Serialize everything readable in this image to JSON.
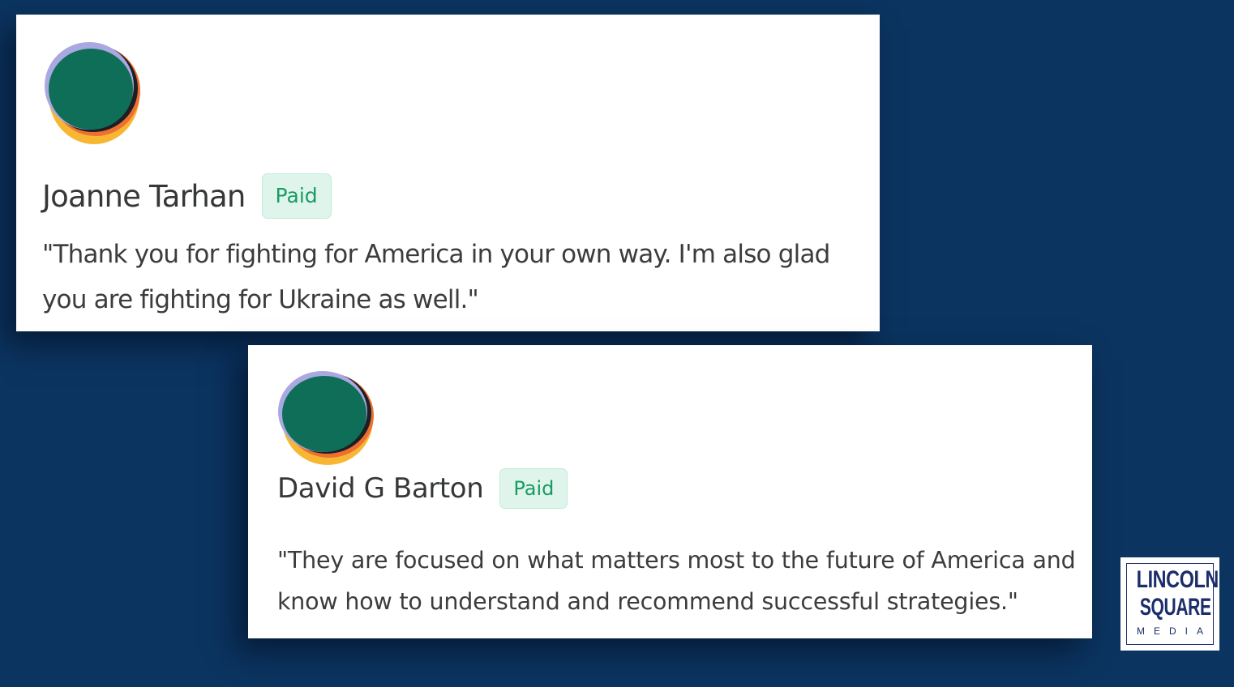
{
  "colors": {
    "background": "#0b3460",
    "card": "#ffffff",
    "badge_bg": "#dff5ec",
    "badge_text": "#1a9b62",
    "text": "#3b3c3d",
    "logo_navy": "#1b2d6b"
  },
  "comments": [
    {
      "avatar_icon": "abstract-circle-avatar-icon",
      "name": "Joanne Tarhan",
      "badge": "Paid",
      "quote": "\"Thank you for fighting for America in your own way. I'm also glad you are fighting for Ukraine as well.\""
    },
    {
      "avatar_icon": "abstract-circle-avatar-icon",
      "name": "David G Barton",
      "badge": "Paid",
      "quote": "\"They are focused on what matters most to the future of America and know how to understand and recommend successful strategies.\""
    }
  ],
  "logo": {
    "line1": "LINCOLN",
    "line2": "SQUARE",
    "line3": "MEDIA"
  }
}
